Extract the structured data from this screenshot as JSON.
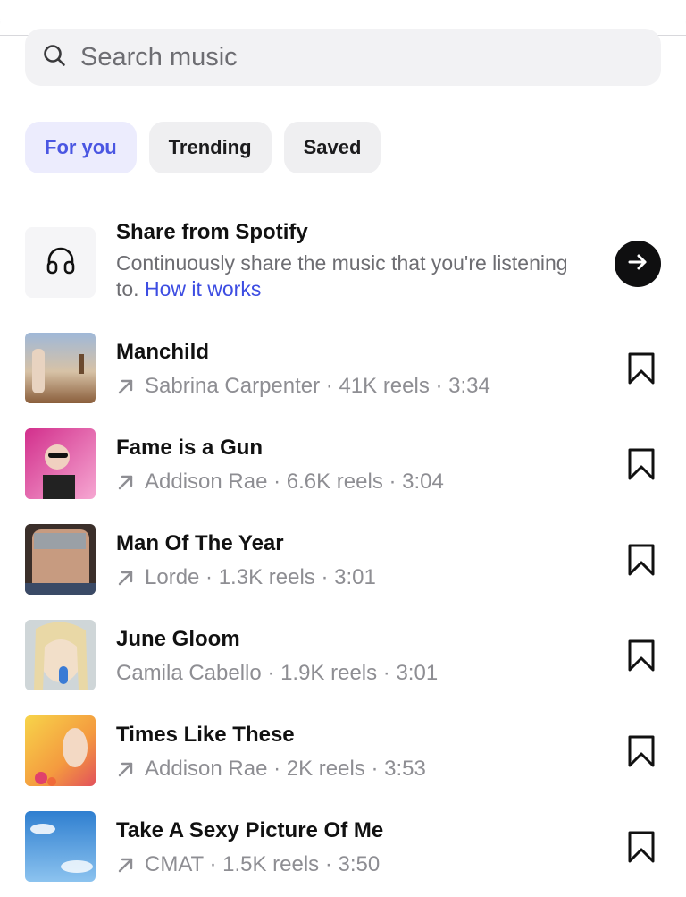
{
  "search": {
    "placeholder": "Search music"
  },
  "tabs": [
    {
      "label": "For you",
      "active": true
    },
    {
      "label": "Trending",
      "active": false
    },
    {
      "label": "Saved",
      "active": false
    }
  ],
  "spotify": {
    "title": "Share from Spotify",
    "description": "Continuously share the music that you're listening to.",
    "link": "How it works"
  },
  "tracks": [
    {
      "title": "Manchild",
      "meta": "Sabrina Carpenter · 41K reels · 3:34",
      "trending": true
    },
    {
      "title": "Fame is a Gun",
      "meta": "Addison Rae · 6.6K reels · 3:04",
      "trending": true
    },
    {
      "title": "Man Of The Year",
      "meta": "Lorde · 1.3K reels · 3:01",
      "trending": true
    },
    {
      "title": "June Gloom",
      "meta": "Camila Cabello · 1.9K reels · 3:01",
      "trending": false
    },
    {
      "title": "Times Like These",
      "meta": "Addison Rae · 2K reels · 3:53",
      "trending": true
    },
    {
      "title": "Take A Sexy Picture Of Me",
      "meta": "CMAT · 1.5K reels · 3:50",
      "trending": true
    }
  ],
  "colors": {
    "accent": "#4a56e2",
    "chip_active_bg": "#ececfd",
    "link": "#3d4de2"
  },
  "icons": {
    "search": "search-icon",
    "spotify": "headphones-icon",
    "go": "arrow-right-icon",
    "trend": "trending-arrow-icon",
    "save": "bookmark-icon"
  }
}
